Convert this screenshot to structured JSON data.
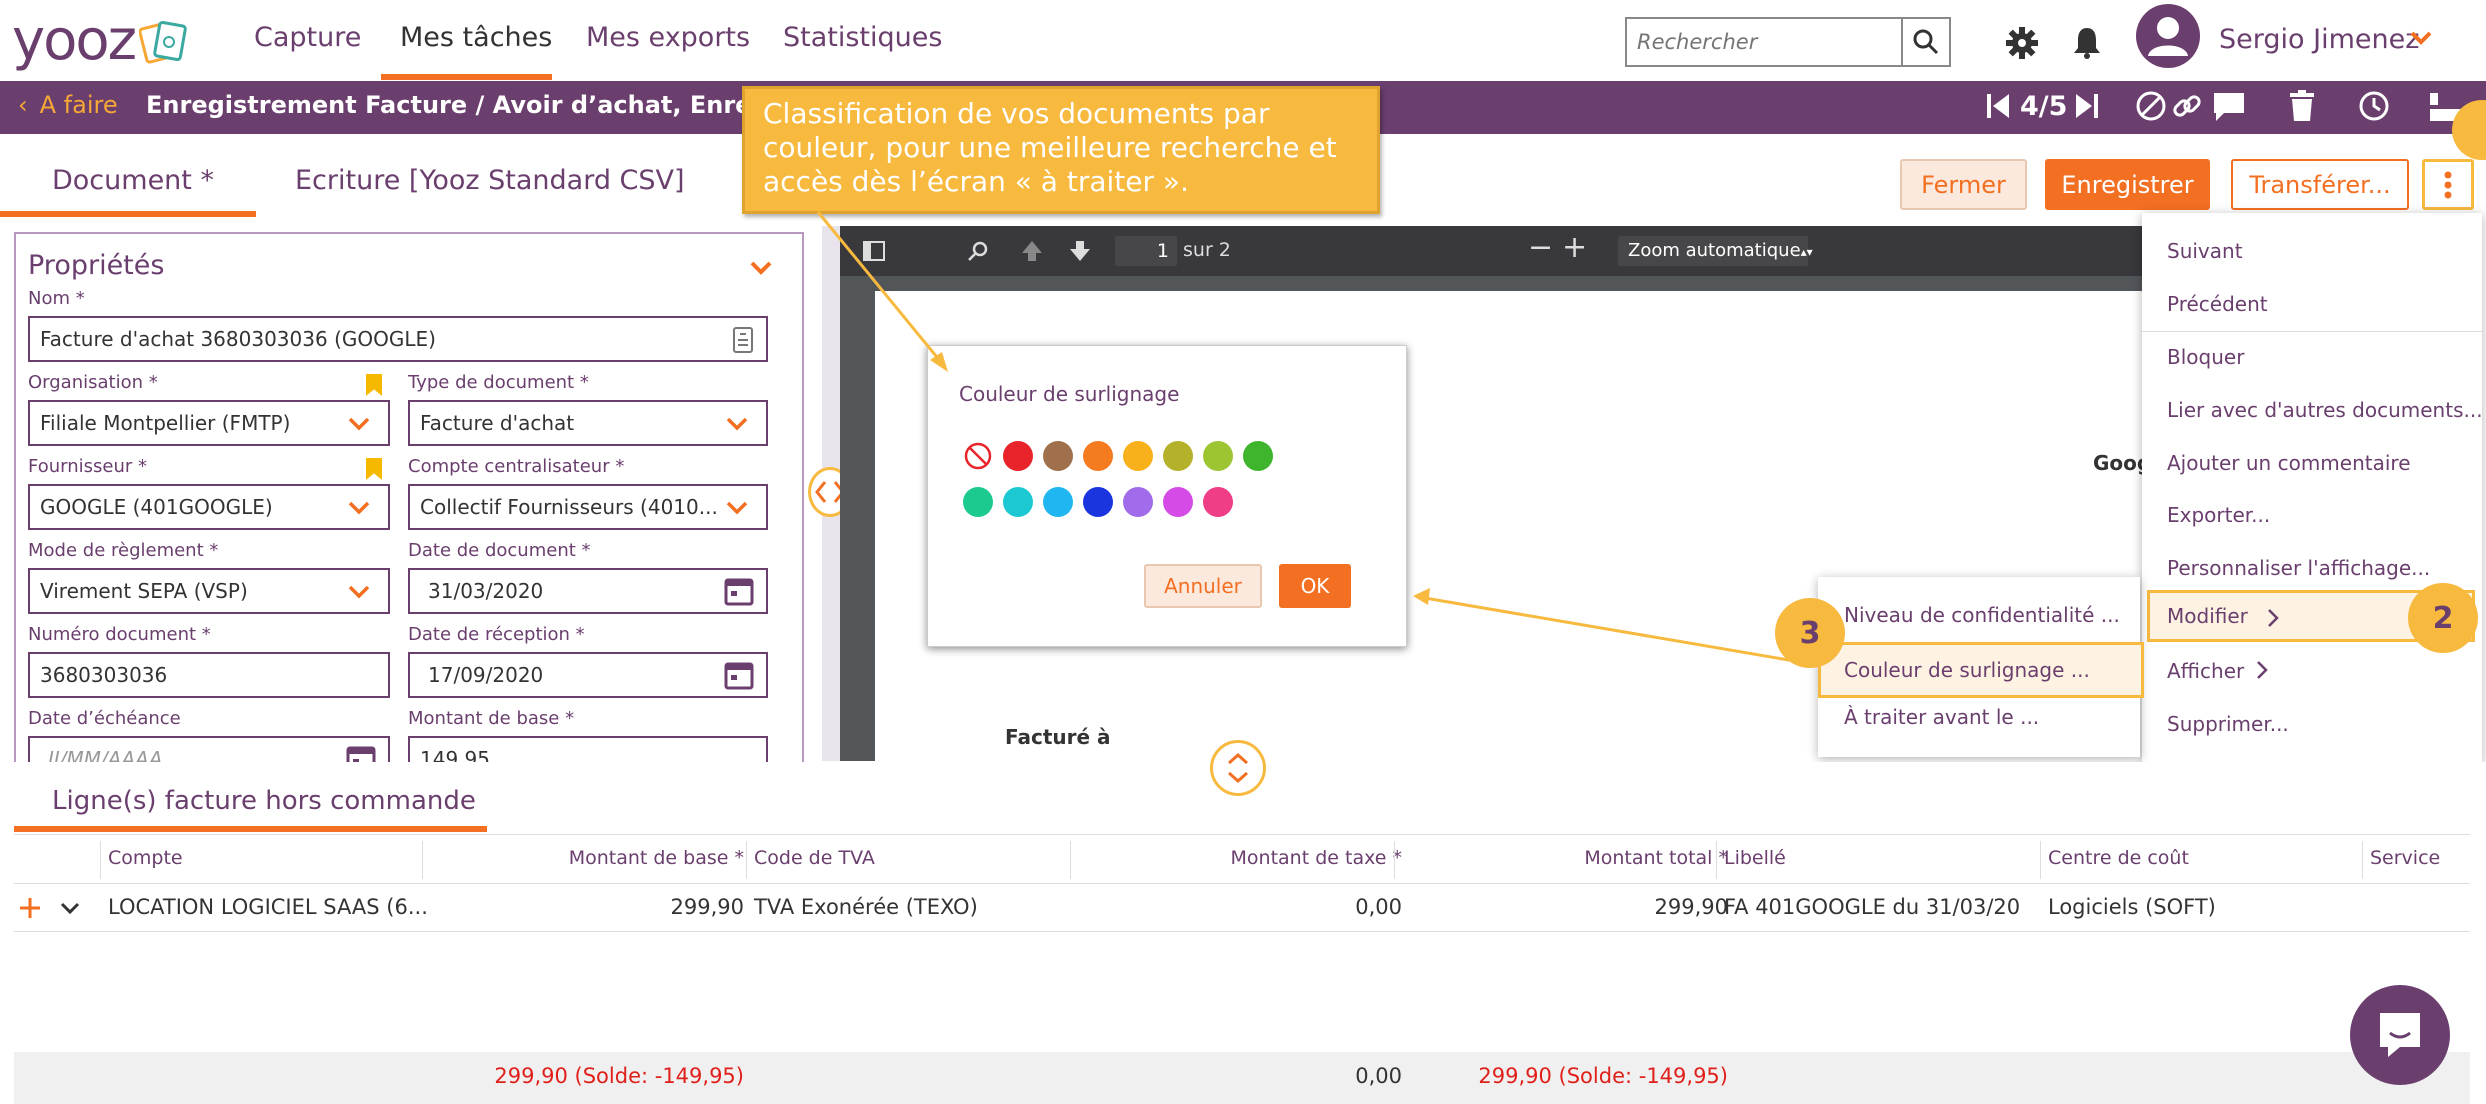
{
  "nav": {
    "logo": "yooz",
    "items": [
      "Capture",
      "Mes tâches",
      "Mes exports",
      "Statistiques"
    ],
    "search_placeholder": "Rechercher",
    "user_name": "Sergio Jimenez"
  },
  "subheader": {
    "back_label": "A faire",
    "title": "Enregistrement Facture / Avoir d’achat, Enregistrement",
    "pager": "4/5"
  },
  "tooltip": {
    "text": "Classification de vos documents par couleur, pour une meilleure recherche et accès dès l’écran « à traiter »."
  },
  "tabs": {
    "document": "Document *",
    "ecriture": "Ecriture [Yooz Standard CSV]"
  },
  "actions": {
    "fermer": "Fermer",
    "enregistrer": "Enregistrer",
    "transferer": "Transférer..."
  },
  "properties": {
    "title": "Propriétés",
    "fields": {
      "nom": {
        "label": "Nom *",
        "value": "Facture d'achat 3680303036 (GOOGLE)"
      },
      "organisation": {
        "label": "Organisation *",
        "value": "Filiale Montpellier (FMTP)"
      },
      "type_document": {
        "label": "Type de document *",
        "value": "Facture d'achat"
      },
      "fournisseur": {
        "label": "Fournisseur *",
        "value": "GOOGLE (401GOOGLE)"
      },
      "compte_centralisateur": {
        "label": "Compte centralisateur *",
        "value": "Collectif Fournisseurs (4010..."
      },
      "mode_reglement": {
        "label": "Mode de règlement *",
        "value": "Virement SEPA (VSP)"
      },
      "date_document": {
        "label": "Date de document *",
        "value": "31/03/2020"
      },
      "numero_document": {
        "label": "Numéro document *",
        "value": "3680303036"
      },
      "date_reception": {
        "label": "Date de réception *",
        "value": "17/09/2020"
      },
      "date_echeance": {
        "label": "Date d’échéance",
        "placeholder": "JJ/MM/AAAA"
      },
      "montant_base": {
        "label": "Montant de base *",
        "value": "149,95"
      }
    }
  },
  "viewer": {
    "page": "1",
    "page_total": "sur 2",
    "zoom": "Zoom automatique",
    "doc_text_google": "Goog",
    "doc_text_facture": "Facturé à"
  },
  "color_dialog": {
    "title": "Couleur de surlignage",
    "colors_row1": [
      "#e8242a",
      "#a0704c",
      "#f47b20",
      "#f9b11b",
      "#b5b12a",
      "#9dc431",
      "#3fb52e"
    ],
    "colors_row2": [
      "#1cc98f",
      "#1cc9d3",
      "#1fb6f1",
      "#1a35e0",
      "#a06cec",
      "#d54be6",
      "#ef3d86"
    ],
    "cancel": "Annuler",
    "ok": "OK"
  },
  "menu": {
    "items": [
      "Suivant",
      "Précédent",
      "Bloquer",
      "Lier avec d'autres documents...",
      "Ajouter un commentaire",
      "Exporter...",
      "Personnaliser l'affichage...",
      "Modifier",
      "Afficher",
      "Supprimer..."
    ]
  },
  "submenu": {
    "items": [
      "Niveau de confidentialité ...",
      "Couleur de surlignage ...",
      "À traiter avant le ..."
    ]
  },
  "badges": {
    "b2": "2",
    "b3": "3"
  },
  "lines": {
    "title": "Ligne(s) facture hors commande",
    "headers": [
      "Compte",
      "Montant de base *",
      "Code de TVA",
      "Montant de taxe *",
      "Montant total *",
      "Libellé",
      "Centre de coût",
      "Service"
    ],
    "row": [
      "LOCATION LOGICIEL SAAS (6...",
      "299,90",
      "TVA Exonérée (TEXO)",
      "0,00",
      "299,90",
      "FA 401GOOGLE du 31/03/20",
      "Logiciels (SOFT)"
    ],
    "footer": [
      "299,90 (Solde: -149,95)",
      "0,00",
      "299,90 (Solde: -149,95)"
    ]
  },
  "colors": {
    "purple": "#6a3f6e",
    "orange": "#f36f21",
    "tooltip": "#f7b93e"
  }
}
